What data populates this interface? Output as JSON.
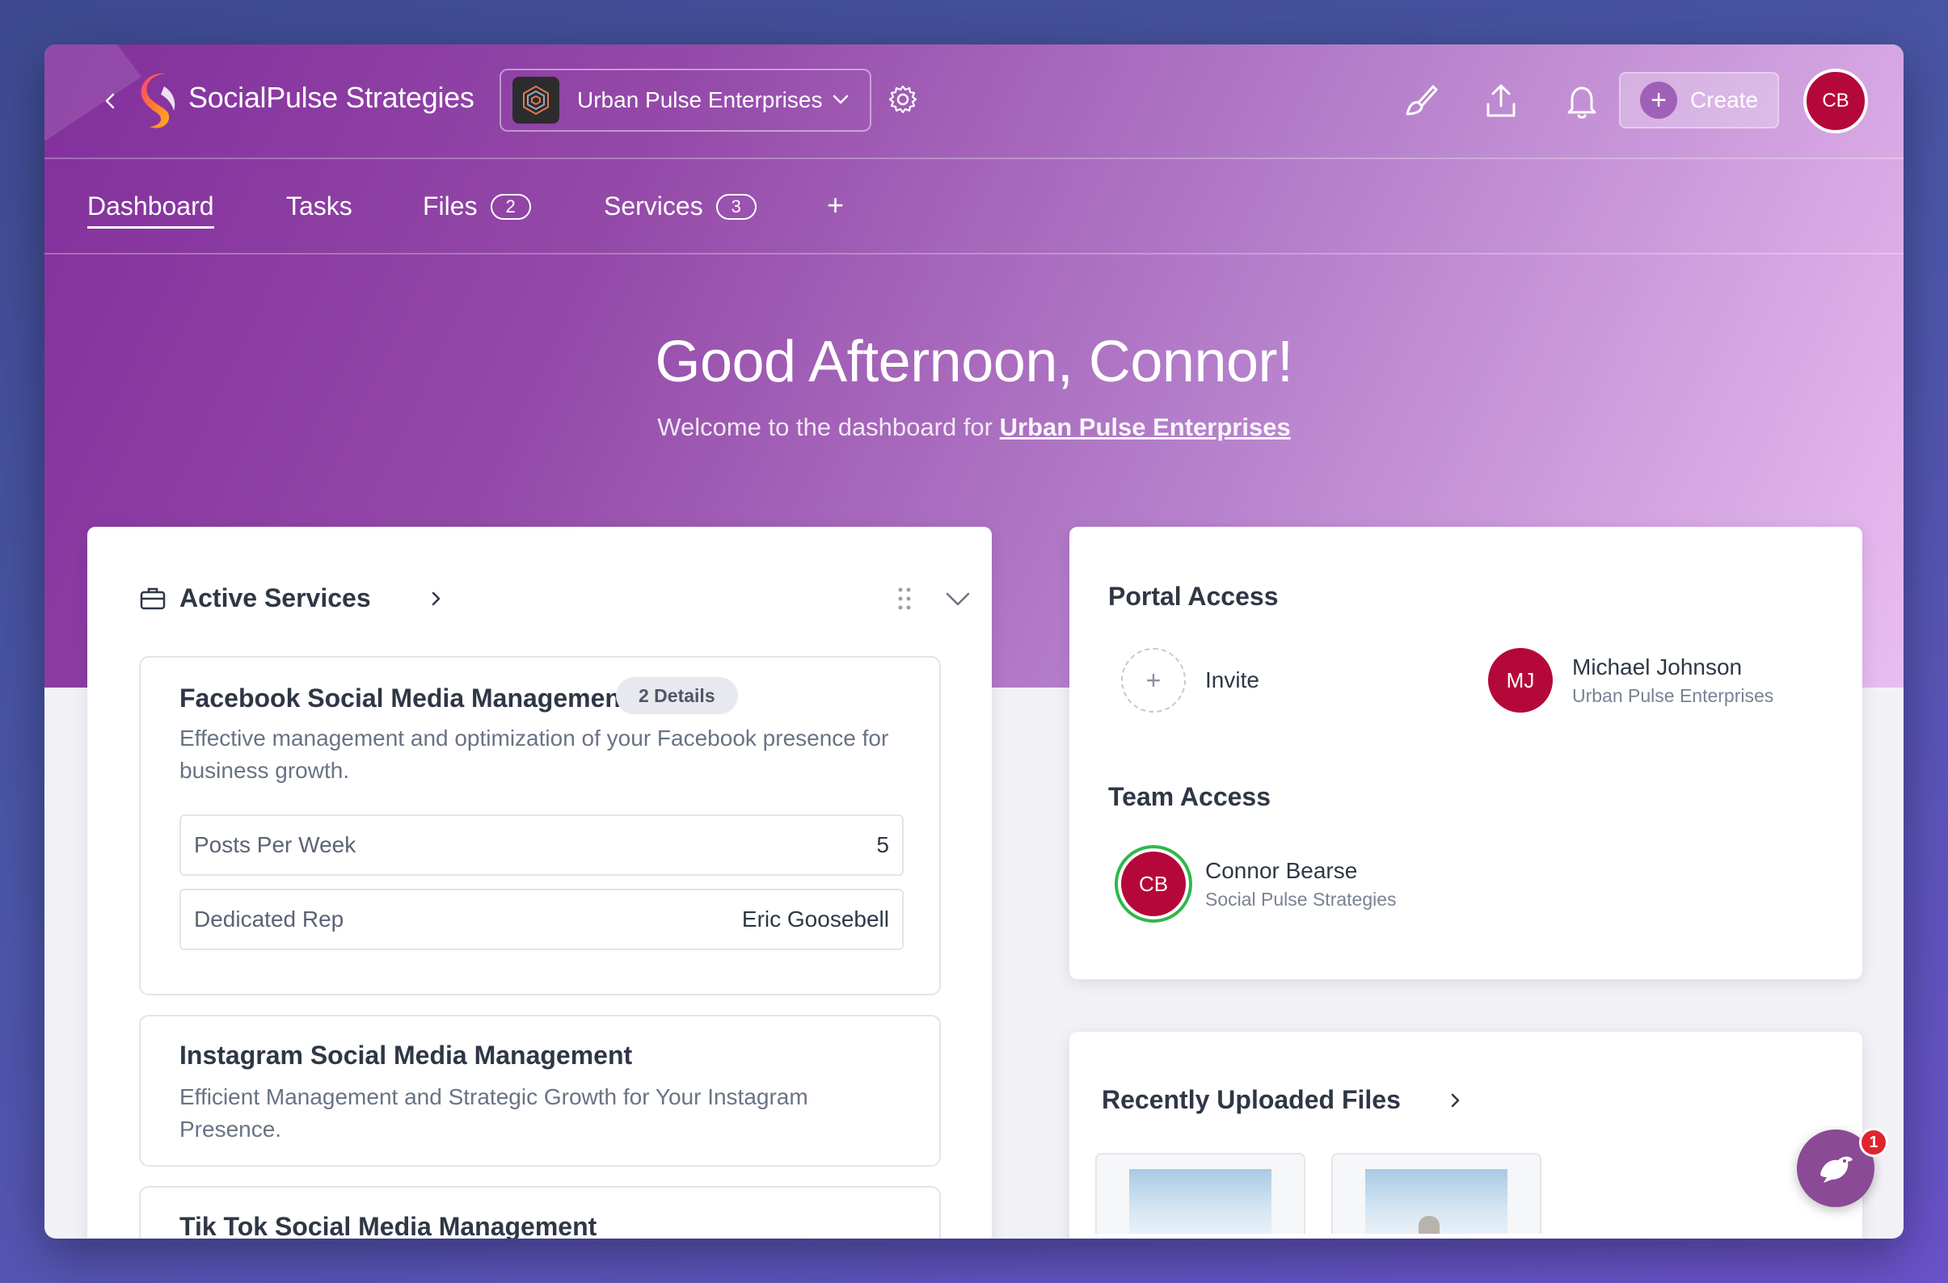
{
  "app": {
    "brand": "SocialPulse Strategies",
    "workspace": "Urban Pulse Enterprises",
    "create_label": "Create",
    "user_initials": "CB"
  },
  "nav": {
    "tabs": [
      {
        "label": "Dashboard",
        "active": true
      },
      {
        "label": "Tasks"
      },
      {
        "label": "Files",
        "badge": "2"
      },
      {
        "label": "Services",
        "badge": "3"
      }
    ],
    "add_label": "+"
  },
  "greeting": {
    "title": "Good Afternoon, Connor!",
    "welcome_prefix": "Welcome to the dashboard for",
    "welcome_link": "Urban Pulse Enterprises"
  },
  "active_services": {
    "title": "Active Services",
    "services": [
      {
        "name": "Facebook Social Media Management",
        "details_pill": "2 Details",
        "description": "Effective management and optimization of your Facebook presence for business growth.",
        "details": [
          {
            "label": "Posts Per Week",
            "value": "5"
          },
          {
            "label": "Dedicated Rep",
            "value": "Eric Goosebell"
          }
        ]
      },
      {
        "name": "Instagram Social Media Management",
        "description": "Efficient Management and Strategic Growth for Your Instagram Presence."
      },
      {
        "name": "Tik Tok Social Media Management"
      }
    ]
  },
  "portal_access": {
    "title": "Portal Access",
    "invite_label": "Invite",
    "members": [
      {
        "initials": "MJ",
        "name": "Michael Johnson",
        "org": "Urban Pulse Enterprises"
      }
    ]
  },
  "team_access": {
    "title": "Team Access",
    "members": [
      {
        "initials": "CB",
        "name": "Connor Bearse",
        "org": "Social Pulse Strategies"
      }
    ]
  },
  "recent_files": {
    "title": "Recently Uploaded Files"
  },
  "chat": {
    "badge": "1"
  },
  "colors": {
    "accent": "#8a3aa3",
    "avatar": "#b5083a",
    "online_ring": "#2fb84a",
    "badge_red": "#e0242f"
  }
}
